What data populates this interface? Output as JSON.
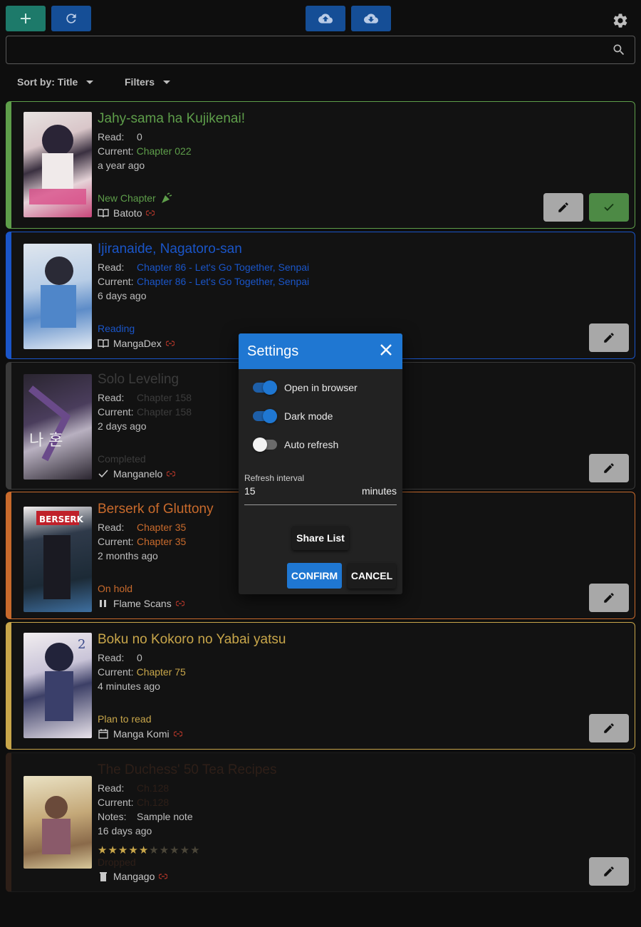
{
  "toolbar": {
    "add_icon": "plus-icon",
    "refresh_icon": "refresh-icon",
    "upload_icon": "cloud-upload-icon",
    "download_icon": "cloud-download-icon",
    "settings_icon": "gear-icon"
  },
  "search": {
    "value": "",
    "placeholder": "",
    "icon": "search-icon"
  },
  "sort": {
    "label": "Sort by: Title"
  },
  "filters": {
    "label": "Filters"
  },
  "labels": {
    "read": "Read:",
    "current": "Current:",
    "notes": "Notes:"
  },
  "cards": [
    {
      "title": "Jahy-sama ha Kujikenai!",
      "read": "0",
      "current": "Chapter 022",
      "updated": "a year ago",
      "status": "New Chapter",
      "status_icon": "party-popper-icon",
      "source": "Batoto",
      "source_icon": "book-open-icon",
      "color": "#5e9e4a"
    },
    {
      "title": "Ijiranaide, Nagatoro-san",
      "read": "Chapter 86 - Let's Go Together, Senpai",
      "current": "Chapter 86 - Let's Go Together, Senpai",
      "updated": "6 days ago",
      "status": "Reading",
      "source": "MangaDex",
      "source_icon": "book-open-icon",
      "color": "#1a55c8"
    },
    {
      "title": "Solo Leveling",
      "read": "Chapter 158",
      "current": "Chapter 158",
      "updated": "2 days ago",
      "status": "Completed",
      "source": "Manganelo",
      "source_icon": "check-icon",
      "color": "#3a3a3a"
    },
    {
      "title": "Berserk of Gluttony",
      "read": "Chapter 35",
      "current": "Chapter 35",
      "updated": "2 months ago",
      "status": "On hold",
      "source": "Flame Scans",
      "source_icon": "pause-icon",
      "color": "#c86a2c"
    },
    {
      "title": "Boku no Kokoro no Yabai yatsu",
      "read": "0",
      "current": "Chapter 75",
      "updated": "4 minutes ago",
      "status": "Plan to read",
      "source": "Manga Komi",
      "source_icon": "calendar-icon",
      "color": "#c8a64a"
    },
    {
      "title": "The Duchess' 50 Tea Recipes",
      "read": "Ch.128",
      "current": "Ch.128",
      "notes": "Sample note",
      "updated": "16 days ago",
      "rating": 5,
      "rating_max": 10,
      "status": "Dropped",
      "source": "Mangago",
      "source_icon": "trash-icon",
      "color": "#2e1f18"
    }
  ],
  "settings_dialog": {
    "title": "Settings",
    "open_in_browser": {
      "label": "Open in browser",
      "on": true
    },
    "dark_mode": {
      "label": "Dark mode",
      "on": true
    },
    "auto_refresh": {
      "label": "Auto refresh",
      "on": false
    },
    "refresh_interval": {
      "label": "Refresh interval",
      "value": "15",
      "unit": "minutes"
    },
    "share_label": "Share List",
    "confirm_label": "CONFIRM",
    "cancel_label": "CANCEL"
  }
}
